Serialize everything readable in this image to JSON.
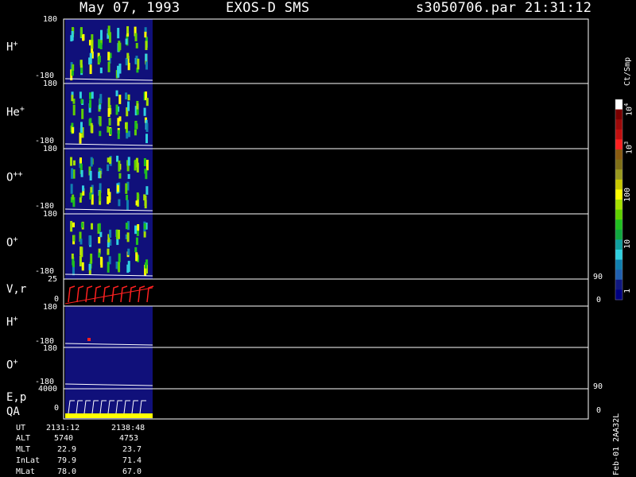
{
  "header": {
    "date": "May 07, 1993",
    "instrument": "EXOS-D SMS",
    "file": "s3050706.par",
    "time": "21:31:12"
  },
  "panels": [
    {
      "label": "H",
      "sup": "+",
      "top": "180",
      "bottom": "-180"
    },
    {
      "label": "He",
      "sup": "+",
      "top": "180",
      "bottom": "-180"
    },
    {
      "label": "O",
      "sup": "++",
      "top": "180",
      "bottom": "-180"
    },
    {
      "label": "O",
      "sup": "+",
      "top": "180",
      "bottom": "-180"
    },
    {
      "label": "V,r",
      "sup": "",
      "top": "25",
      "bottom": "0",
      "right_top": "90",
      "right_bottom": "0"
    },
    {
      "label": "H",
      "sup": "+",
      "top": "180",
      "bottom": "-180"
    },
    {
      "label": "O",
      "sup": "+",
      "top": "180",
      "bottom": "-180"
    },
    {
      "label": "E,p",
      "sup": "",
      "label2": "QA",
      "top": "4000",
      "bottom": "0",
      "right_top": "90",
      "right_bottom": "0"
    }
  ],
  "colorbar": {
    "unit": "Ct/Smp",
    "labels": [
      "10^4",
      "10^3",
      "100",
      "10",
      "1"
    ],
    "colors": [
      "#ffffff",
      "#7a0000",
      "#9c0a0a",
      "#c01010",
      "#ff2020",
      "#8a5a10",
      "#807018",
      "#9a9a20",
      "#c8c800",
      "#ffff00",
      "#a6e000",
      "#60d000",
      "#20c020",
      "#10a840",
      "#10a0a0",
      "#30d0e0",
      "#1080b0",
      "#2060b0",
      "#101880",
      "#000080"
    ]
  },
  "footer": {
    "rows": [
      {
        "name": "UT",
        "v1": "2131:12",
        "v2": "2138:48"
      },
      {
        "name": "ALT",
        "v1": "5740",
        "v2": "4753"
      },
      {
        "name": "MLT",
        "v1": "22.9",
        "v2": "23.7"
      },
      {
        "name": "InLat",
        "v1": "79.9",
        "v2": "71.4"
      },
      {
        "name": "MLat",
        "v1": "78.0",
        "v2": "67.0"
      }
    ],
    "stamp": "Feb-01 2AA32L"
  },
  "chart_data": {
    "type": "heatmap",
    "title": "May 07, 1993   EXOS-D SMS",
    "x_start": "2131:12",
    "x_end": "2138:48",
    "series": [
      {
        "name": "H+",
        "ylim": [
          -180,
          180
        ]
      },
      {
        "name": "He+",
        "ylim": [
          -180,
          180
        ]
      },
      {
        "name": "O++",
        "ylim": [
          -180,
          180
        ]
      },
      {
        "name": "O+",
        "ylim": [
          -180,
          180
        ]
      },
      {
        "name": "V,r",
        "ylim": [
          0,
          25
        ],
        "right_ylim": [
          0,
          90
        ]
      },
      {
        "name": "H+",
        "ylim": [
          -180,
          180
        ]
      },
      {
        "name": "O+",
        "ylim": [
          -180,
          180
        ]
      },
      {
        "name": "E,p",
        "ylim": [
          0,
          4000
        ],
        "right_ylim": [
          0,
          90
        ]
      }
    ],
    "colorbar_unit": "Ct/Smp",
    "colorbar_ticks": [
      "1",
      "10",
      "100",
      "10^3",
      "10^4"
    ]
  }
}
